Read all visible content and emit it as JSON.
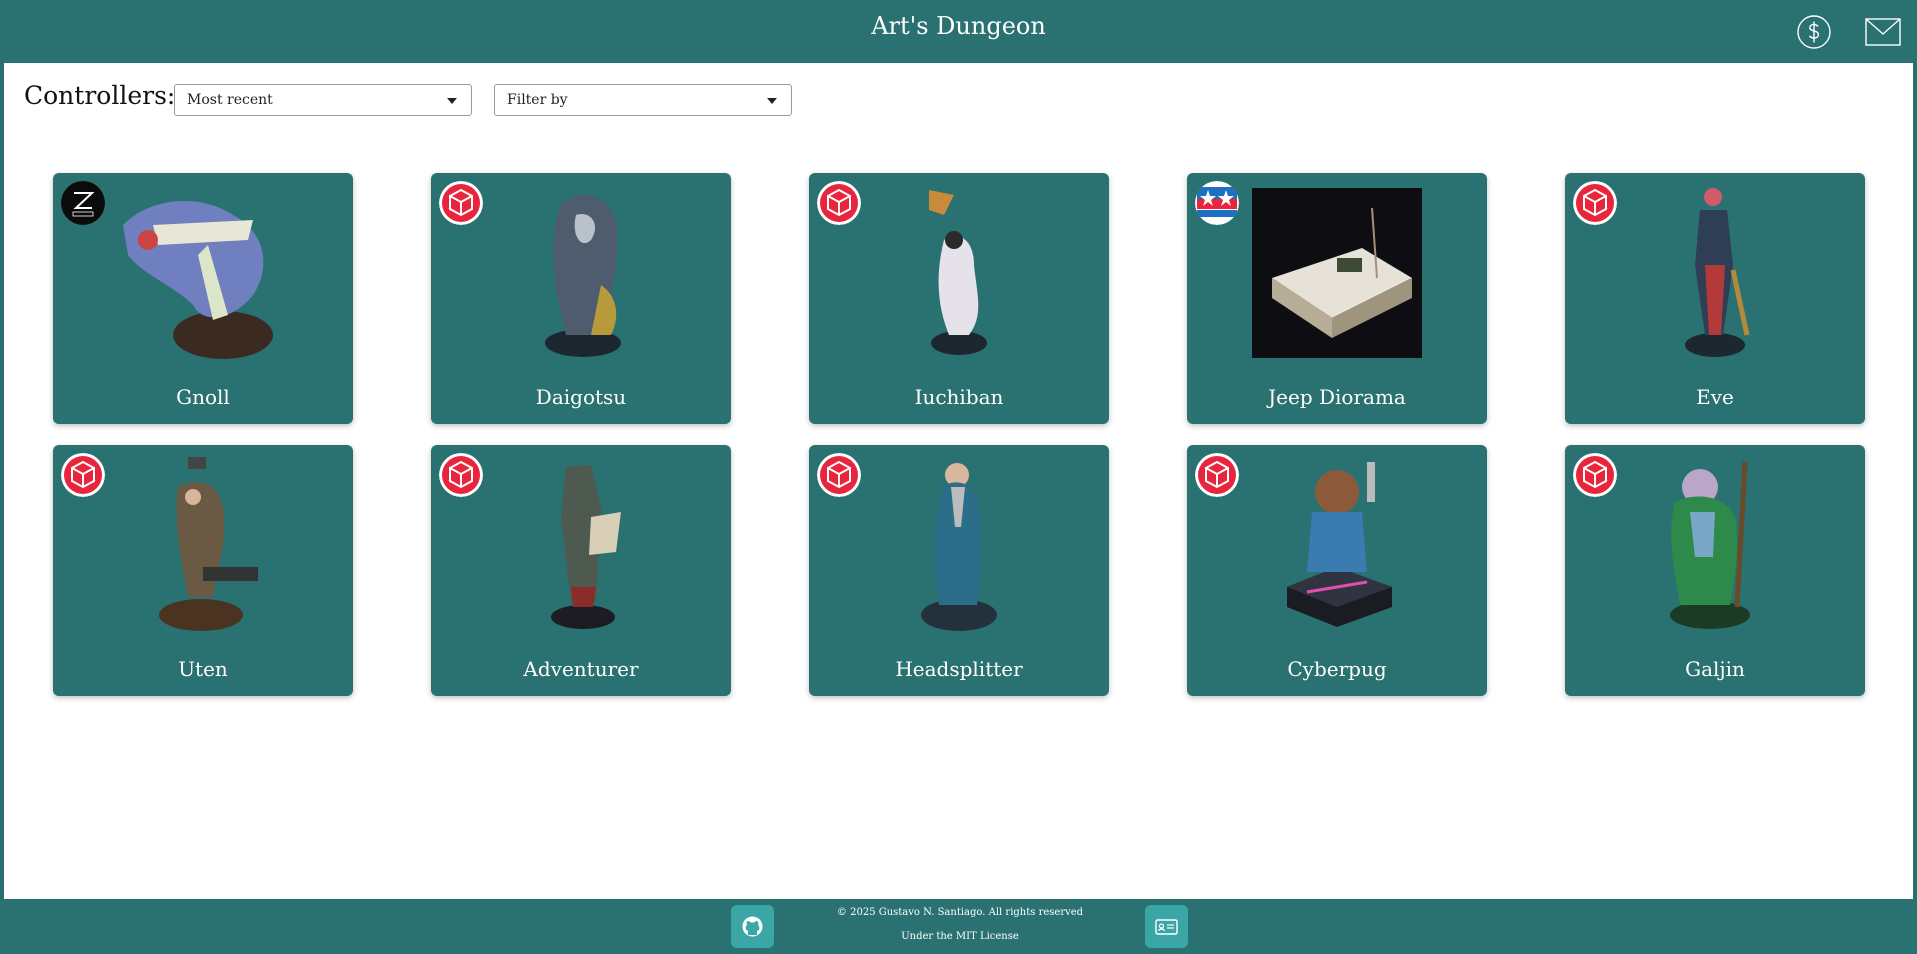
{
  "header": {
    "title": "Art's Dungeon",
    "icons": [
      "dollar-icon",
      "mail-icon"
    ]
  },
  "controls": {
    "label": "Controllers:",
    "sort_value": "Most recent",
    "filter_value": "Filter by"
  },
  "cards": [
    {
      "name": "Gnoll",
      "badge": "4250-logo"
    },
    {
      "name": "Daigotsu",
      "badge": "red-cube-logo"
    },
    {
      "name": "Iuchiban",
      "badge": "red-cube-logo"
    },
    {
      "name": "Jeep Diorama",
      "badge": "tamiya-logo"
    },
    {
      "name": "Eve",
      "badge": "red-cube-logo"
    },
    {
      "name": "Uten",
      "badge": "red-cube-logo"
    },
    {
      "name": "Adventurer",
      "badge": "red-cube-logo"
    },
    {
      "name": "Headsplitter",
      "badge": "red-cube-logo"
    },
    {
      "name": "Cyberpug",
      "badge": "red-cube-logo"
    },
    {
      "name": "Galjin",
      "badge": "red-cube-logo"
    }
  ],
  "footer": {
    "copyright": "© 2025 Gustavo N. Santiago. All rights reserved",
    "license": "Under the MIT License",
    "icons": [
      "github-icon",
      "id-card-icon"
    ]
  },
  "colors": {
    "teal": "#2a7172",
    "footer_button": "#3aa6a6",
    "badge_red": "#e8253c"
  }
}
